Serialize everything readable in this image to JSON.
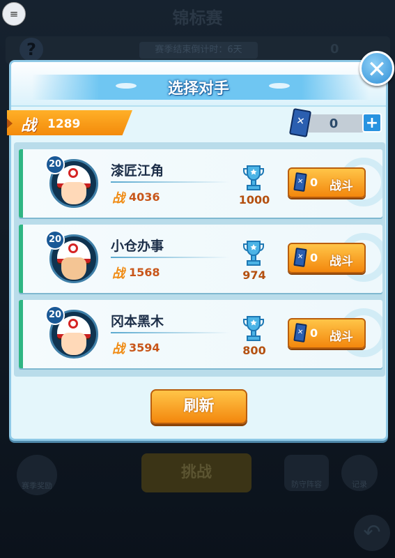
{
  "background": {
    "title": "锦标赛",
    "countdown": "赛季结束倒计时：6天",
    "help_glyph": "?",
    "ticket_count": "0",
    "gift_label": "赛季奖励",
    "challenge_label": "挑战",
    "defense_label": "防守阵容",
    "record_label": "记录",
    "menu_glyph": "≡",
    "back_glyph": "↶"
  },
  "dialog": {
    "title": "选择对手",
    "close_glyph": "✕",
    "power_glyph": "战",
    "player_power": "1289",
    "tickets": "0",
    "plus_glyph": "+",
    "refresh_label": "刷新"
  },
  "opponents": [
    {
      "level": "20",
      "name": "漆匠江角",
      "power": "4036",
      "trophies": "1000",
      "cost": "0",
      "fight_label": "战斗"
    },
    {
      "level": "20",
      "name": "小仓办事",
      "power": "1568",
      "trophies": "974",
      "cost": "0",
      "fight_label": "战斗"
    },
    {
      "level": "20",
      "name": "冈本黑木",
      "power": "3594",
      "trophies": "800",
      "cost": "0",
      "fight_label": "战斗"
    }
  ],
  "colors": {
    "accent_orange": "#f3870d",
    "panel_bg": "#e4f6fb",
    "title_blue": "#6fc6f2",
    "card_stripe": "#2fb683"
  }
}
